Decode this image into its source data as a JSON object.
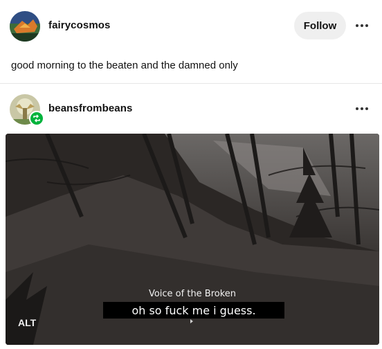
{
  "post1": {
    "username": "fairycosmos",
    "follow_label": "Follow",
    "body": "good morning to the beaten and the damned only"
  },
  "post2": {
    "username": "beansfrombeans",
    "image": {
      "speaker": "Voice of the Broken",
      "subtitle": "oh so fuck me i guess.",
      "alt_label": "ALT"
    }
  },
  "colors": {
    "follow_bg": "#efefef",
    "reblog_badge": "#00b33c"
  },
  "icons": [
    "more-icon",
    "reblog-icon"
  ]
}
